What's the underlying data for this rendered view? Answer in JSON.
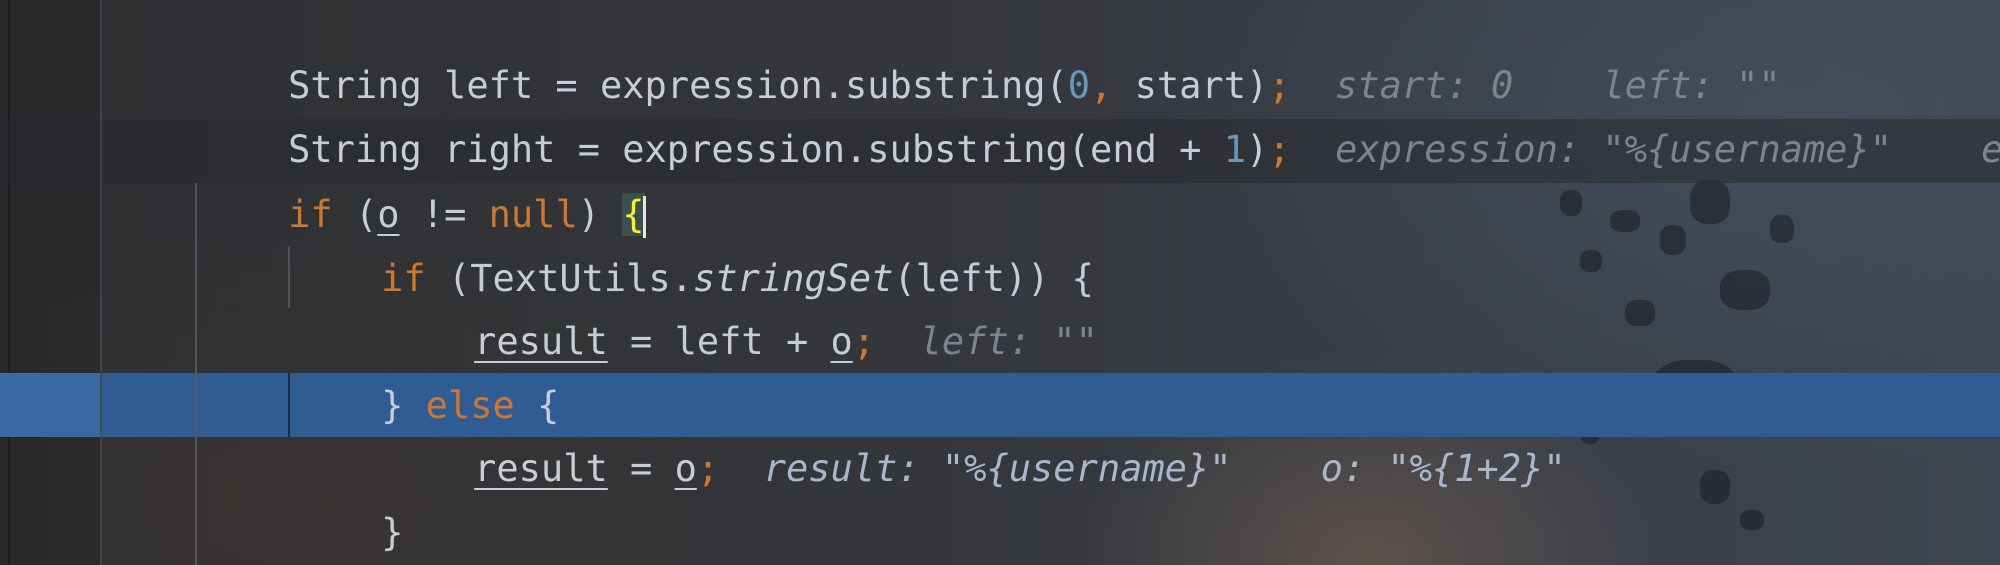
{
  "editor": {
    "lines": [
      {
        "text_a": "String left = expression.substring(",
        "num_a": "0",
        "text_b": ", start)",
        "semi": ";",
        "hints": [
          "start: 0",
          "left: \"\""
        ]
      },
      {
        "text_a": "String right = expression.substring(end + ",
        "num_a": "1",
        "text_b": ")",
        "semi": ";",
        "hints": [
          "expression: \"%{username}\"",
          "e"
        ]
      },
      {
        "kw_if": "if",
        "paren_open": " (",
        "var_o": "o",
        "op": " != ",
        "kw_null": "null",
        "paren_close": ") ",
        "brace": "{"
      },
      {
        "kw_if": "if",
        "text_a": " (TextUtils.",
        "method": "stringSet",
        "text_b": "(left)) {"
      },
      {
        "var_result": "result",
        "text_a": " = left + ",
        "var_o": "o",
        "semi": ";",
        "hint": "left: \"\""
      },
      {
        "close": "} ",
        "kw_else": "else",
        "open": " {"
      },
      {
        "var_result": "result",
        "text_a": " = ",
        "var_o": "o",
        "semi": ";",
        "hints": [
          "result: \"%{username}\"",
          "o: \"%{1+2}\""
        ]
      },
      {
        "close": "}"
      }
    ]
  },
  "colors": {
    "keyword": "#cc7832",
    "number": "#6897bb",
    "execution_line": "#2f5d93",
    "brace_match": "#ffef28"
  }
}
